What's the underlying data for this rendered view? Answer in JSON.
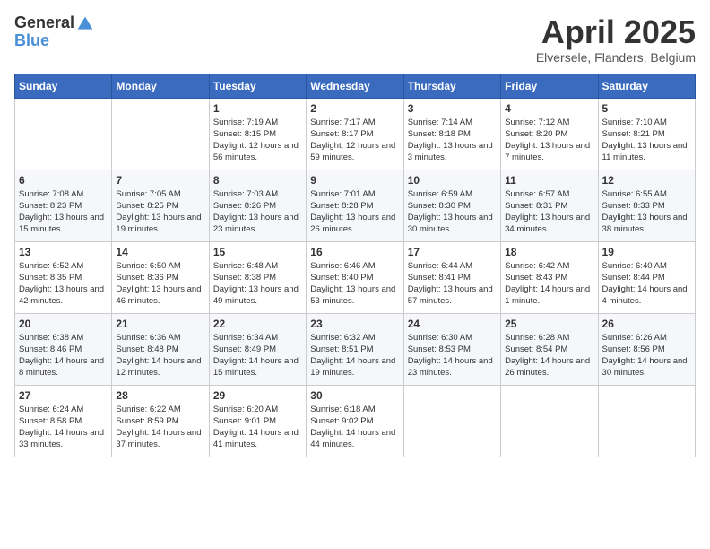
{
  "logo": {
    "general": "General",
    "blue": "Blue"
  },
  "title": "April 2025",
  "location": "Elversele, Flanders, Belgium",
  "days_header": [
    "Sunday",
    "Monday",
    "Tuesday",
    "Wednesday",
    "Thursday",
    "Friday",
    "Saturday"
  ],
  "weeks": [
    [
      {
        "num": "",
        "info": ""
      },
      {
        "num": "",
        "info": ""
      },
      {
        "num": "1",
        "info": "Sunrise: 7:19 AM\nSunset: 8:15 PM\nDaylight: 12 hours and 56 minutes."
      },
      {
        "num": "2",
        "info": "Sunrise: 7:17 AM\nSunset: 8:17 PM\nDaylight: 12 hours and 59 minutes."
      },
      {
        "num": "3",
        "info": "Sunrise: 7:14 AM\nSunset: 8:18 PM\nDaylight: 13 hours and 3 minutes."
      },
      {
        "num": "4",
        "info": "Sunrise: 7:12 AM\nSunset: 8:20 PM\nDaylight: 13 hours and 7 minutes."
      },
      {
        "num": "5",
        "info": "Sunrise: 7:10 AM\nSunset: 8:21 PM\nDaylight: 13 hours and 11 minutes."
      }
    ],
    [
      {
        "num": "6",
        "info": "Sunrise: 7:08 AM\nSunset: 8:23 PM\nDaylight: 13 hours and 15 minutes."
      },
      {
        "num": "7",
        "info": "Sunrise: 7:05 AM\nSunset: 8:25 PM\nDaylight: 13 hours and 19 minutes."
      },
      {
        "num": "8",
        "info": "Sunrise: 7:03 AM\nSunset: 8:26 PM\nDaylight: 13 hours and 23 minutes."
      },
      {
        "num": "9",
        "info": "Sunrise: 7:01 AM\nSunset: 8:28 PM\nDaylight: 13 hours and 26 minutes."
      },
      {
        "num": "10",
        "info": "Sunrise: 6:59 AM\nSunset: 8:30 PM\nDaylight: 13 hours and 30 minutes."
      },
      {
        "num": "11",
        "info": "Sunrise: 6:57 AM\nSunset: 8:31 PM\nDaylight: 13 hours and 34 minutes."
      },
      {
        "num": "12",
        "info": "Sunrise: 6:55 AM\nSunset: 8:33 PM\nDaylight: 13 hours and 38 minutes."
      }
    ],
    [
      {
        "num": "13",
        "info": "Sunrise: 6:52 AM\nSunset: 8:35 PM\nDaylight: 13 hours and 42 minutes."
      },
      {
        "num": "14",
        "info": "Sunrise: 6:50 AM\nSunset: 8:36 PM\nDaylight: 13 hours and 46 minutes."
      },
      {
        "num": "15",
        "info": "Sunrise: 6:48 AM\nSunset: 8:38 PM\nDaylight: 13 hours and 49 minutes."
      },
      {
        "num": "16",
        "info": "Sunrise: 6:46 AM\nSunset: 8:40 PM\nDaylight: 13 hours and 53 minutes."
      },
      {
        "num": "17",
        "info": "Sunrise: 6:44 AM\nSunset: 8:41 PM\nDaylight: 13 hours and 57 minutes."
      },
      {
        "num": "18",
        "info": "Sunrise: 6:42 AM\nSunset: 8:43 PM\nDaylight: 14 hours and 1 minute."
      },
      {
        "num": "19",
        "info": "Sunrise: 6:40 AM\nSunset: 8:44 PM\nDaylight: 14 hours and 4 minutes."
      }
    ],
    [
      {
        "num": "20",
        "info": "Sunrise: 6:38 AM\nSunset: 8:46 PM\nDaylight: 14 hours and 8 minutes."
      },
      {
        "num": "21",
        "info": "Sunrise: 6:36 AM\nSunset: 8:48 PM\nDaylight: 14 hours and 12 minutes."
      },
      {
        "num": "22",
        "info": "Sunrise: 6:34 AM\nSunset: 8:49 PM\nDaylight: 14 hours and 15 minutes."
      },
      {
        "num": "23",
        "info": "Sunrise: 6:32 AM\nSunset: 8:51 PM\nDaylight: 14 hours and 19 minutes."
      },
      {
        "num": "24",
        "info": "Sunrise: 6:30 AM\nSunset: 8:53 PM\nDaylight: 14 hours and 23 minutes."
      },
      {
        "num": "25",
        "info": "Sunrise: 6:28 AM\nSunset: 8:54 PM\nDaylight: 14 hours and 26 minutes."
      },
      {
        "num": "26",
        "info": "Sunrise: 6:26 AM\nSunset: 8:56 PM\nDaylight: 14 hours and 30 minutes."
      }
    ],
    [
      {
        "num": "27",
        "info": "Sunrise: 6:24 AM\nSunset: 8:58 PM\nDaylight: 14 hours and 33 minutes."
      },
      {
        "num": "28",
        "info": "Sunrise: 6:22 AM\nSunset: 8:59 PM\nDaylight: 14 hours and 37 minutes."
      },
      {
        "num": "29",
        "info": "Sunrise: 6:20 AM\nSunset: 9:01 PM\nDaylight: 14 hours and 41 minutes."
      },
      {
        "num": "30",
        "info": "Sunrise: 6:18 AM\nSunset: 9:02 PM\nDaylight: 14 hours and 44 minutes."
      },
      {
        "num": "",
        "info": ""
      },
      {
        "num": "",
        "info": ""
      },
      {
        "num": "",
        "info": ""
      }
    ]
  ]
}
